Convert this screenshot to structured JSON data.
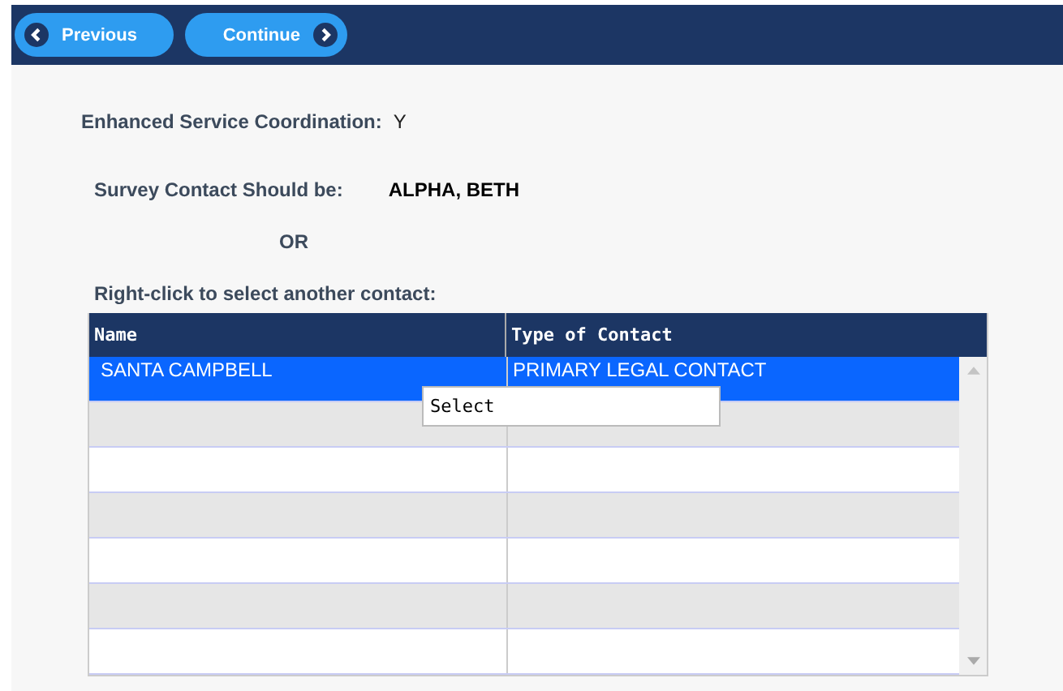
{
  "toolbar": {
    "buttons": [
      {
        "label": "Previous",
        "kind": "back"
      },
      {
        "label": "Continue",
        "kind": "forward"
      }
    ]
  },
  "enhanced": {
    "label": "Enhanced Service Coordination:",
    "value": "Y"
  },
  "survey_contact": {
    "label": "Survey Contact Should be:",
    "value": "ALPHA, BETH"
  },
  "or_text": "OR",
  "instruction": "Right-click to select another contact:",
  "table": {
    "columns": [
      "Name",
      "Type of Contact"
    ],
    "rows": [
      {
        "name": "SANTA CAMPBELL",
        "type": "PRIMARY LEGAL CONTACT",
        "selected": true
      },
      {
        "selected": false
      },
      {
        "selected": false
      },
      {
        "selected": false
      },
      {
        "selected": false
      },
      {
        "selected": false
      },
      {
        "selected": false
      }
    ]
  },
  "context_menu": {
    "items": [
      "Select"
    ]
  }
}
